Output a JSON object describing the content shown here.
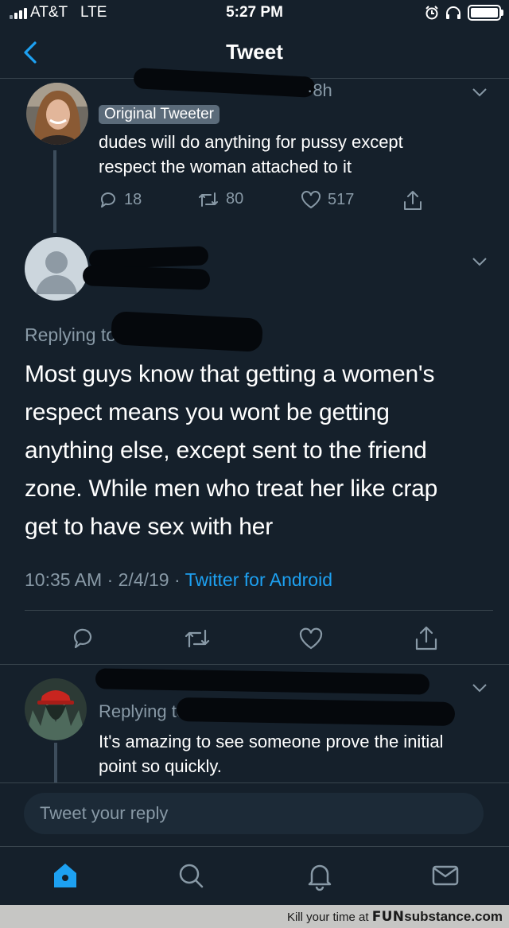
{
  "status": {
    "carrier": "AT&T",
    "network": "LTE",
    "time": "5:27 PM"
  },
  "header": {
    "title": "Tweet"
  },
  "tweet1": {
    "time": "·8h",
    "badge": "Original Tweeter",
    "text_line1": "dudes will do anything for pussy except",
    "text_line2": "respect the woman attached to it",
    "replies": "18",
    "retweets": "80",
    "likes": "517"
  },
  "main_tweet": {
    "replying_prefix": "Replying to",
    "line1": "Most guys know that getting a women's",
    "line2": "respect means you wont be getting",
    "line3": "anything else, except sent to the friend",
    "line4": "zone. While men who treat her like crap",
    "line5": "get to have sex with her",
    "time": "10:35 AM",
    "date": "2/4/19",
    "separator": "·",
    "source": "Twitter for Android"
  },
  "reply_tweet": {
    "replying_prefix": "Replying to",
    "text_line1": "It's amazing to see someone prove the initial",
    "text_line2": "point so quickly."
  },
  "reply_box": {
    "placeholder": "Tweet your reply"
  },
  "watermark": {
    "prefix": "Kill your time at",
    "brand_fun": "FUN",
    "brand_rest": "substance.com"
  },
  "colors": {
    "background": "#15202b",
    "accent": "#1da1f2",
    "muted": "#8899a6"
  },
  "icons": [
    "back-icon",
    "reply-icon",
    "retweet-icon",
    "like-icon",
    "share-icon",
    "chevron-down-icon",
    "home-icon",
    "search-icon",
    "notifications-icon",
    "messages-icon"
  ]
}
